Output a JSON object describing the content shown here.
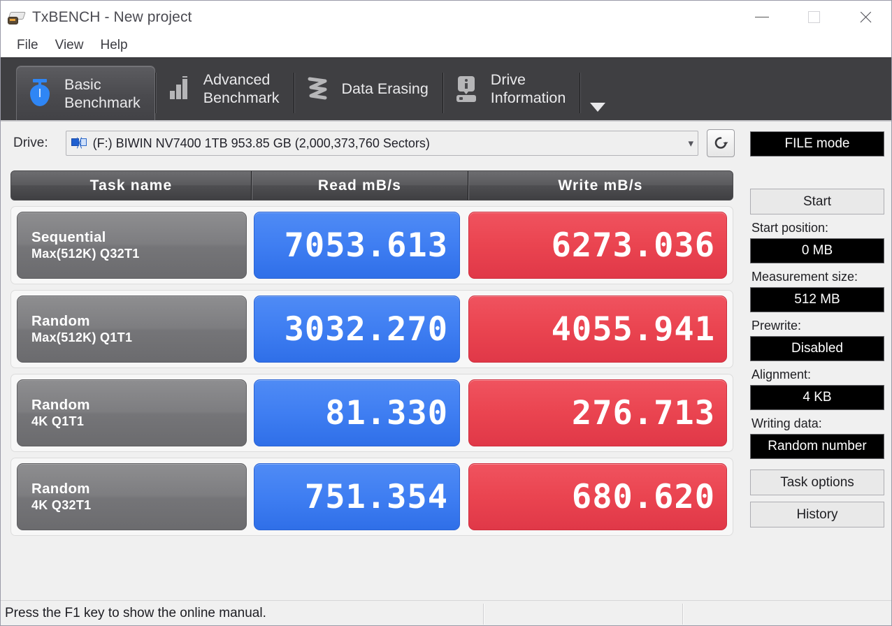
{
  "window": {
    "title": "TxBENCH - New project",
    "icon": "hdd-icon",
    "controls": [
      {
        "name": "minimize-button",
        "glyph": "minimize-icon"
      },
      {
        "name": "maximize-button",
        "glyph": "maximize-icon"
      },
      {
        "name": "close-button",
        "glyph": "close-icon"
      }
    ]
  },
  "menu": {
    "items": [
      {
        "label": "File"
      },
      {
        "label": "View"
      },
      {
        "label": "Help"
      }
    ]
  },
  "tabs": {
    "overflow_icon": "chevron-down-icon",
    "items": [
      {
        "line1": "Basic",
        "line2": "Benchmark",
        "icon": "stopwatch-icon",
        "active": true
      },
      {
        "line1": "Advanced",
        "line2": "Benchmark",
        "icon": "bar-chart-icon",
        "active": false
      },
      {
        "line1": "Data Erasing",
        "line2": "",
        "icon": "zigzag-icon",
        "active": false
      },
      {
        "line1": "Drive",
        "line2": "Information",
        "icon": "drive-info-icon",
        "active": false
      }
    ]
  },
  "drive": {
    "label": "Drive:",
    "selected": "(F:) BIWIN NV7400 1TB  953.85 GB (2,000,373,760 Sectors)",
    "dropdown_icon": "chevron-down-icon",
    "drive_icon": "network-drive-icon",
    "refresh_icon": "refresh-icon"
  },
  "table": {
    "headers": [
      "Task name",
      "Read mB/s",
      "Write mB/s"
    ],
    "rows": [
      {
        "task_line1": "Sequential",
        "task_line2": "Max(512K) Q32T1",
        "read": "7053.613",
        "write": "6273.036"
      },
      {
        "task_line1": "Random",
        "task_line2": "Max(512K) Q1T1",
        "read": "3032.270",
        "write": "4055.941"
      },
      {
        "task_line1": "Random",
        "task_line2": "4K Q1T1",
        "read": "81.330",
        "write": "276.713"
      },
      {
        "task_line1": "Random",
        "task_line2": "4K Q32T1",
        "read": "751.354",
        "write": "680.620"
      }
    ]
  },
  "sidebar": {
    "mode": "FILE mode",
    "start_button": "Start",
    "start_position_label": "Start position:",
    "start_position_value": "0 MB",
    "measurement_size_label": "Measurement size:",
    "measurement_size_value": "512 MB",
    "prewrite_label": "Prewrite:",
    "prewrite_value": "Disabled",
    "alignment_label": "Alignment:",
    "alignment_value": "4 KB",
    "writing_data_label": "Writing data:",
    "writing_data_value": "Random number",
    "task_options_button": "Task options",
    "history_button": "History"
  },
  "statusbar": {
    "message": "Press the F1 key to show the online manual."
  },
  "colors": {
    "read_accent": "#3f7ef2",
    "write_accent": "#ea4450",
    "tab_bg": "#3f3f42",
    "header_bg": "#4f4f52"
  },
  "chart_data": {
    "type": "bar",
    "title": "TxBENCH Basic Benchmark Results",
    "xlabel": "Task",
    "ylabel": "mB/s",
    "categories": [
      "Sequential Max(512K) Q32T1",
      "Random Max(512K) Q1T1",
      "Random 4K Q1T1",
      "Random 4K Q32T1"
    ],
    "series": [
      {
        "name": "Read mB/s",
        "values": [
          7053.613,
          3032.27,
          81.33,
          751.354
        ]
      },
      {
        "name": "Write mB/s",
        "values": [
          6273.036,
          4055.941,
          276.713,
          680.62
        ]
      }
    ]
  }
}
